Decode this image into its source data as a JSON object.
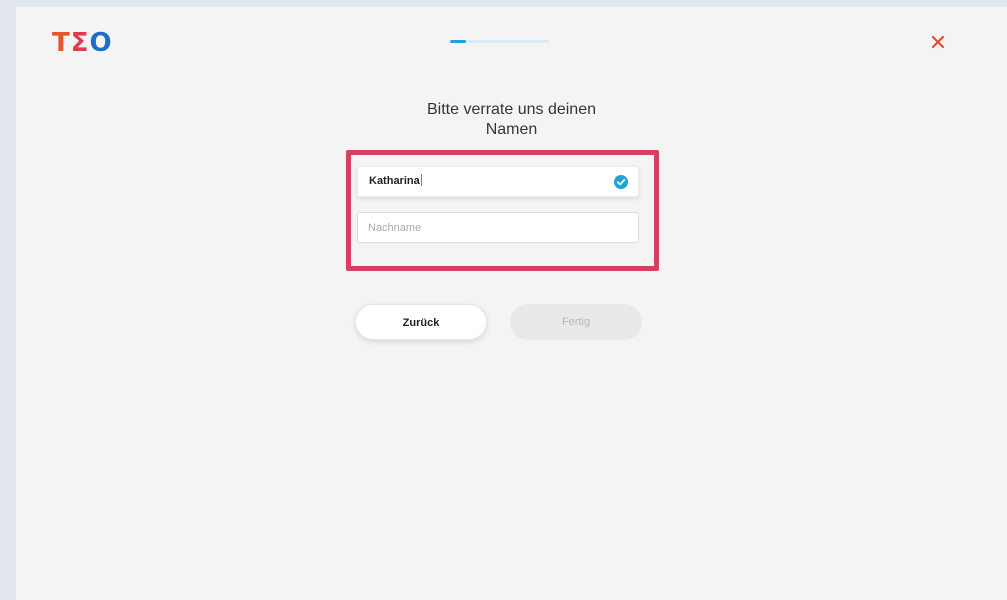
{
  "header": {
    "logo": {
      "part1": "T",
      "part2": "Σ",
      "part3": "O"
    },
    "progress_fraction": 0.16,
    "close_symbol": "✕"
  },
  "main": {
    "heading_line1": "Bitte verrate uns deinen",
    "heading_line2": "Namen",
    "first_name": {
      "value": "Katharina",
      "status_icon": "check-circle-icon"
    },
    "last_name": {
      "value": "",
      "placeholder": "Nachname"
    },
    "back_label": "Zurück",
    "done_label": "Fertig"
  },
  "colors": {
    "accent": "#1da3d6",
    "close": "#e5483a",
    "highlight": "#d8405f",
    "disabled": "#e9e9e9"
  }
}
